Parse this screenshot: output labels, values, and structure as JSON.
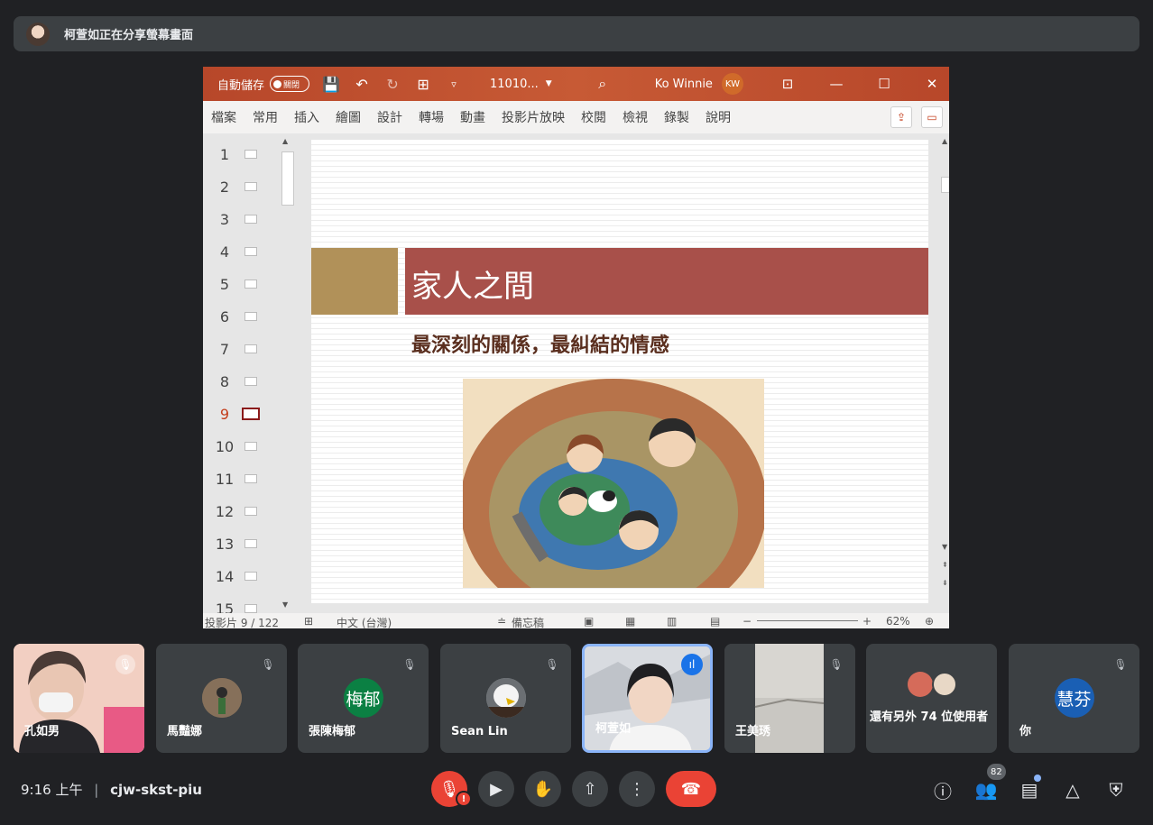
{
  "banner": {
    "text": "柯萱如正在分享螢幕畫面"
  },
  "ppt": {
    "autosave_label": "自動儲存",
    "autosave_state": "關閉",
    "file_name": "11010...",
    "user_name": "Ko Winnie",
    "user_initials": "KW",
    "ribbon_tabs": [
      "檔案",
      "常用",
      "插入",
      "繪圖",
      "設計",
      "轉場",
      "動畫",
      "投影片放映",
      "校閱",
      "檢視",
      "錄製",
      "說明"
    ],
    "thumbs": [
      "1",
      "2",
      "3",
      "4",
      "5",
      "6",
      "7",
      "8",
      "9",
      "10",
      "11",
      "12",
      "13",
      "14",
      "15"
    ],
    "active_slide": "9",
    "slide": {
      "title": "家人之間",
      "subtitle": "最深刻的關係，最糾結的情感"
    },
    "status": {
      "slide_count": "投影片 9 / 122",
      "language": "中文 (台灣)",
      "notes": "備忘稿",
      "zoom": "62%"
    }
  },
  "participants": [
    {
      "name": "孔如男",
      "type": "video",
      "muted": true
    },
    {
      "name": "馬豔娜",
      "type": "avatar",
      "muted": true
    },
    {
      "name": "張陳梅郁",
      "initials": "梅郁",
      "color": "#0b8043",
      "muted": true
    },
    {
      "name": "Sean Lin",
      "type": "avatar",
      "muted": true
    },
    {
      "name": "柯萱如",
      "type": "video",
      "speaking": true
    },
    {
      "name": "王美琇",
      "type": "video",
      "muted": true
    },
    {
      "name": "還有另外 74 位使用者"
    },
    {
      "name": "你",
      "initials": "慧芬",
      "color": "#1a5fb4",
      "muted": true
    }
  ],
  "meeting": {
    "time": "9:16 上午",
    "separator": "|",
    "code": "cjw-skst-piu",
    "people_count": "82"
  }
}
